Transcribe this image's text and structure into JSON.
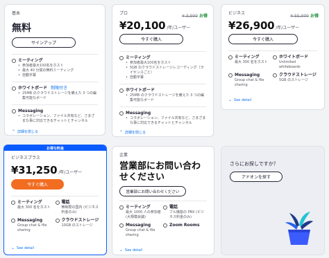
{
  "free": {
    "tier": "基本",
    "title": "無料",
    "button": "サインアップ",
    "meeting": {
      "title": "ミーティング",
      "bullets": [
        "参加者最大100名をホスト",
        "最大 40 分間の無料ミーティング",
        "自動字幕"
      ]
    },
    "whiteboard": {
      "title": "ホワイトボード",
      "badge": "制限付き",
      "bullets": [
        "25MB のクラウドストレージを備えた 3 つの編集可能なボード"
      ]
    },
    "messaging": {
      "title": "Messaging",
      "bullets": [
        "コラボレーション、ファイル共有など、さまざまな事に対応できるチャットとチャンネル"
      ]
    },
    "link": "詳細を閉じる"
  },
  "pro": {
    "tier": "プロ",
    "original_price": "¥ 3,900",
    "save": "お得",
    "price": "¥20,100",
    "unit": "/年/ユーザー",
    "button": "今すぐ購入",
    "meeting": {
      "title": "ミーティング",
      "bullets": [
        "参加者最大100名をホスト",
        "5GB のクラウドストレージレコーディング（ライセンスごと）",
        "自動字幕"
      ]
    },
    "whiteboard": {
      "title": "ホワイトボード",
      "bullets": [
        "25MB のクラウドストレージを備えた 3 つの編集可能なボード"
      ]
    },
    "messaging": {
      "title": "Messaging",
      "bullets": [
        "コラボレーション、ファイル共有など、さまざまな事に対応できるチャットとチャンネル"
      ]
    },
    "link": "詳細を閉じる"
  },
  "business": {
    "tier": "ビジネス",
    "original_price": "¥ 55,000",
    "save": "お得",
    "price": "¥26,900",
    "unit": "/年/ユーザー",
    "button": "今すぐ購入",
    "features": [
      {
        "title": "ミーティング",
        "sub": "最大 300 名をホスト"
      },
      {
        "title": "ホワイトボード",
        "sub": "Unlimited whiteboards"
      },
      {
        "title": "Messaging",
        "sub": "Group chat & file sharing"
      },
      {
        "title": "クラウドストレージ",
        "sub": "5GB のストレージ"
      }
    ],
    "link": "See detail"
  },
  "business_plus": {
    "ribbon": "お得な料金",
    "tier": "ビジネスプラス",
    "price": "¥31,250",
    "unit": "/年/ユーザー",
    "button": "今すぐ購入",
    "features": [
      {
        "title": "ミーティング",
        "sub": "最大 300 名をホスト"
      },
      {
        "title": "電話",
        "sub": "無制限の国内 (ビジネス料金のみ)"
      },
      {
        "title": "Messaging",
        "sub": "Group chat & file sharing"
      },
      {
        "title": "クラウドストレージ",
        "sub": "10GB のストレージ"
      }
    ],
    "link": "See detail"
  },
  "enterprise": {
    "tier": "企業",
    "title": "営業部にお問い合わせください",
    "button": "営業部にお問い合わせください",
    "features": [
      {
        "title": "ミーティング",
        "sub": "最大 1000 人の参加者 (大規模会議)"
      },
      {
        "title": "電話",
        "sub": "フル機能の PBX (ビジネス料金のみ)"
      },
      {
        "title": "Messaging",
        "sub": "Group chat & file sharing"
      },
      {
        "title": "Zoom Rooms",
        "sub": ""
      }
    ],
    "link": "See detail"
  },
  "addon": {
    "prompt": "さらにお探しですか？",
    "button": "アドオンを探す"
  }
}
